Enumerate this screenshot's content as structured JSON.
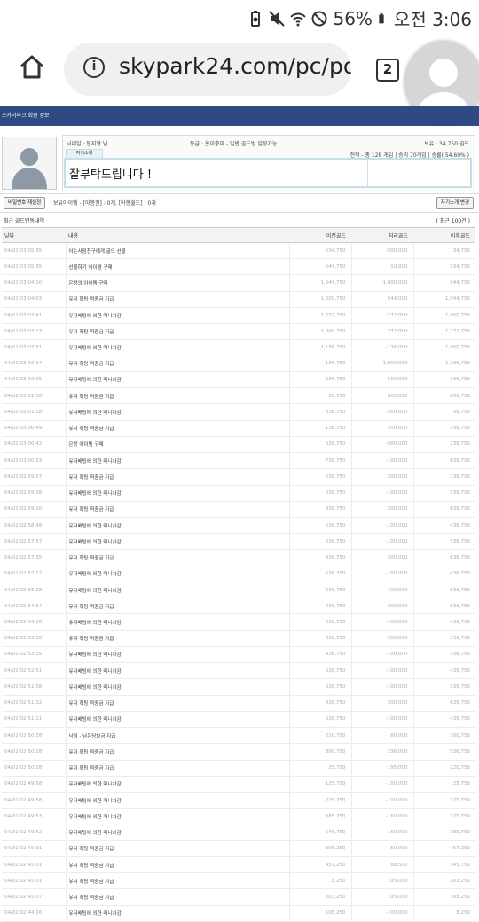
{
  "status_bar": {
    "battery": "56%",
    "time": "오전 3:06"
  },
  "browser": {
    "url": "skypark24.com/pc/pop",
    "tab_count": "2"
  },
  "page": {
    "banner_title": "스카이파크 회원 정보"
  },
  "profile": {
    "nickname": "닉네임 : 문지형 님",
    "grade": "등급 : 온이중미 - 일반 골드방 입장가능",
    "holding": "보유 : 34,750 골드",
    "intro_tab": "자기소개",
    "record": "전적 - 총 128 게임 | 승리 70게임 | 승률( 54.69% )",
    "intro_text": "잘부탁드립니다 !"
  },
  "buttons": {
    "password": "비밀번호 재설정",
    "items": "보유아이템 - [아봉권] : 0개, [아봉쉴드] : 0개",
    "edit_intro": "자기소개 변경"
  },
  "section": {
    "title": "최근 골드변동내역",
    "count": "( 최근 100건 )"
  },
  "table": {
    "headers": [
      "날짜",
      "내용",
      "이전골드",
      "처리골드",
      "이후골드"
    ],
    "rows": [
      [
        "04/02 03:05:35",
        "아는사람친구에게 골드 선물",
        "534,750",
        "-500,000",
        "34,750"
      ],
      [
        "04/02 03:05:35",
        "선물하기 아이템 구매",
        "544,750",
        "-10,000",
        "534,750"
      ],
      [
        "04/02 03:04:10",
        "은방의 아이템 구매",
        "1,544,750",
        "-1,000,000",
        "544,750"
      ],
      [
        "04/02 03:04:03",
        "유저 획팅 적중금 지급",
        "1,000,750",
        "544,000",
        "1,544,750"
      ],
      [
        "04/02 03:03:41",
        "유저배팅에 의한 머니차감",
        "1,272,750",
        "-272,000",
        "1,000,750"
      ],
      [
        "04/02 03:03:13",
        "유저 획팅 적중금 지급",
        "1,000,750",
        "272,000",
        "1,272,750"
      ],
      [
        "04/02 03:02:51",
        "유저배팅에 의한 머니차감",
        "1,136,750",
        "-136,000",
        "1,000,750"
      ],
      [
        "04/02 03:02:24",
        "유저 획팅 적중금 지급",
        "136,750",
        "1,000,000",
        "1,136,750"
      ],
      [
        "04/02 03:02:05",
        "유저배팅에 의한 머니차감",
        "636,750",
        "-500,000",
        "136,750"
      ],
      [
        "04/02 03:01:38",
        "유저 획팅 적중금 지급",
        "36,750",
        "600,000",
        "636,750"
      ],
      [
        "04/02 03:01:18",
        "유저배팅에 의한 머니차감",
        "336,750",
        "-300,000",
        "36,750"
      ],
      [
        "04/02 03:00:49",
        "유저 획팅 적중금 지급",
        "136,750",
        "200,000",
        "336,750"
      ],
      [
        "04/02 03:00:42",
        "은방 아이템 구매",
        "636,750",
        "-500,000",
        "136,750"
      ],
      [
        "04/02 03:00:23",
        "유저배팅에 의한 머니차감",
        "736,750",
        "-100,000",
        "636,750"
      ],
      [
        "04/02 02:59:57",
        "유저 획팅 적중금 지급",
        "536,750",
        "200,000",
        "736,750"
      ],
      [
        "04/02 02:59:38",
        "유저배팅에 의한 머니차감",
        "636,750",
        "-100,000",
        "536,750"
      ],
      [
        "04/02 02:59:10",
        "유저 획팅 적중금 지급",
        "436,750",
        "200,000",
        "636,750"
      ],
      [
        "04/02 02:58:48",
        "유저배팅에 의한 머니차감",
        "536,750",
        "-100,000",
        "436,750"
      ],
      [
        "04/02 02:57:57",
        "유저배팅에 의한 머니차감",
        "636,750",
        "-100,000",
        "536,750"
      ],
      [
        "04/02 02:57:35",
        "유저 획팅 적중금 지급",
        "436,750",
        "200,000",
        "636,750"
      ],
      [
        "04/02 02:57:12",
        "유저배팅에 의한 머니차감",
        "536,750",
        "-100,000",
        "436,750"
      ],
      [
        "04/02 02:55:28",
        "유저배팅에 의한 머니차감",
        "636,750",
        "-100,000",
        "536,750"
      ],
      [
        "04/02 02:54:54",
        "유저 획팅 적중금 지급",
        "436,750",
        "200,000",
        "636,750"
      ],
      [
        "04/02 02:54:26",
        "유저배팅에 의한 머니차감",
        "536,750",
        "-100,000",
        "436,750"
      ],
      [
        "04/02 02:53:58",
        "유저 획팅 적중금 지급",
        "336,750",
        "200,000",
        "536,750"
      ],
      [
        "04/02 02:53:35",
        "유저배팅에 의한 머니차감",
        "436,750",
        "-100,000",
        "336,750"
      ],
      [
        "04/02 02:52:51",
        "유저배팅에 의한 머니차감",
        "536,750",
        "-100,000",
        "436,750"
      ],
      [
        "04/02 02:51:58",
        "유저배팅에 의한 머니차감",
        "636,750",
        "-100,000",
        "536,750"
      ],
      [
        "04/02 02:51:32",
        "유저 획팅 적중금 지급",
        "436,750",
        "200,000",
        "636,750"
      ],
      [
        "04/02 02:51:11",
        "유저배팅에 의한 머니차감",
        "536,750",
        "-100,000",
        "436,750"
      ],
      [
        "04/02 02:50:38",
        "낙첨 - 남은당보금 지급",
        "220,750",
        "80,000",
        "300,750"
      ],
      [
        "04/02 02:50:28",
        "유저 획팅 적중금 지급",
        "300,750",
        "236,000",
        "536,750"
      ],
      [
        "04/02 02:50:28",
        "유저 획팅 적중금 지급",
        "25,750",
        "195,000",
        "220,750"
      ],
      [
        "04/02 02:49:58",
        "유저배팅에 의한 머니차감",
        "125,750",
        "-100,000",
        "25,750"
      ],
      [
        "04/02 02:49:58",
        "유저배팅에 의한 머니차감",
        "225,750",
        "-100,000",
        "125,750"
      ],
      [
        "04/02 02:49:53",
        "유저배팅에 의한 머니차감",
        "385,750",
        "-160,000",
        "225,750"
      ],
      [
        "04/02 02:49:52",
        "유저배팅에 의한 머니차감",
        "545,750",
        "-160,000",
        "385,750"
      ],
      [
        "04/02 02:45:01",
        "유저 획팅 적중금 지급",
        "398,250",
        "59,000",
        "457,250"
      ],
      [
        "04/02 02:45:01",
        "유저 획팅 적중금 지급",
        "457,250",
        "88,500",
        "545,750"
      ],
      [
        "04/02 02:45:01",
        "유저 획팅 적중금 지급",
        "8,250",
        "195,000",
        "203,250"
      ],
      [
        "04/02 02:45:07",
        "유저 획팅 적중금 지급",
        "203,250",
        "195,000",
        "398,250"
      ],
      [
        "04/02 02:44:16",
        "유저배팅에 의한 머니차감",
        "108,250",
        "-100,000",
        "8,250"
      ]
    ]
  }
}
